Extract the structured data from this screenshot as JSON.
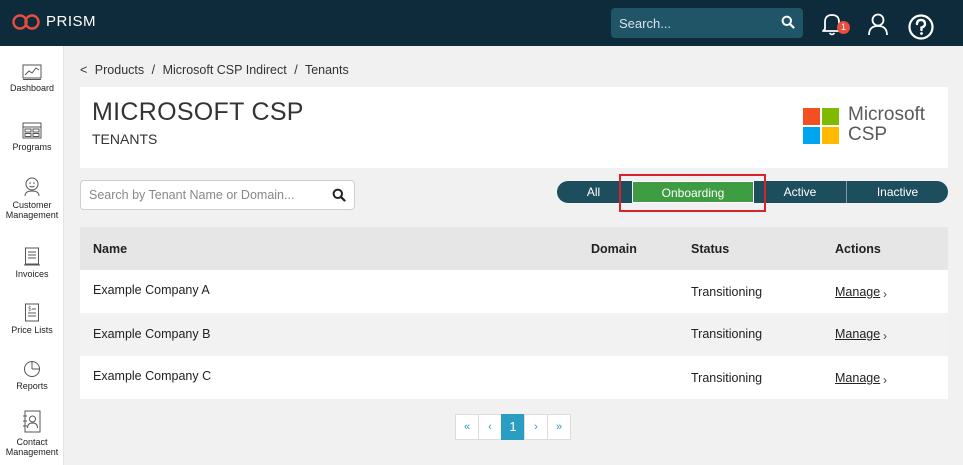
{
  "app": {
    "brand": "PRISM",
    "search_placeholder": "Search...",
    "notification_count": "1",
    "brand_color": "#e84d3d",
    "topbar_color": "#0d2b3a"
  },
  "sidebar": {
    "items": [
      {
        "label": "Dashboard",
        "icon": "dashboard-icon"
      },
      {
        "label": "Programs",
        "icon": "programs-icon"
      },
      {
        "label": "Customer Management",
        "icon": "customer-icon"
      },
      {
        "label": "Invoices",
        "icon": "invoice-icon"
      },
      {
        "label": "Price Lists",
        "icon": "price-list-icon"
      },
      {
        "label": "Reports",
        "icon": "reports-icon"
      },
      {
        "label": "Contact Management",
        "icon": "contact-icon"
      }
    ]
  },
  "breadcrumb": {
    "back": "<",
    "items": [
      "Products",
      "Microsoft CSP Indirect",
      "Tenants"
    ],
    "separator": "/"
  },
  "header": {
    "title": "MICROSOFT CSP",
    "subtitle": "TENANTS",
    "logo_line1": "Microsoft",
    "logo_line2": "CSP"
  },
  "tenant_search": {
    "placeholder": "Search by Tenant Name or Domain..."
  },
  "filters": {
    "items": [
      "All",
      "Onboarding",
      "Active",
      "Inactive"
    ],
    "selected": "Onboarding",
    "active_color": "#3e9d43"
  },
  "table": {
    "columns": [
      "Name",
      "Domain",
      "Status",
      "Actions"
    ],
    "rows": [
      {
        "name": "Example Company A",
        "domain": "",
        "status": "Transitioning",
        "action": "Manage"
      },
      {
        "name": "Example Company B",
        "domain": "",
        "status": "Transitioning",
        "action": "Manage"
      },
      {
        "name": "Example Company C",
        "domain": "",
        "status": "Transitioning",
        "action": "Manage"
      }
    ]
  },
  "pagination": {
    "first": "«",
    "prev": "‹",
    "current": "1",
    "next": "›",
    "last": "»"
  }
}
